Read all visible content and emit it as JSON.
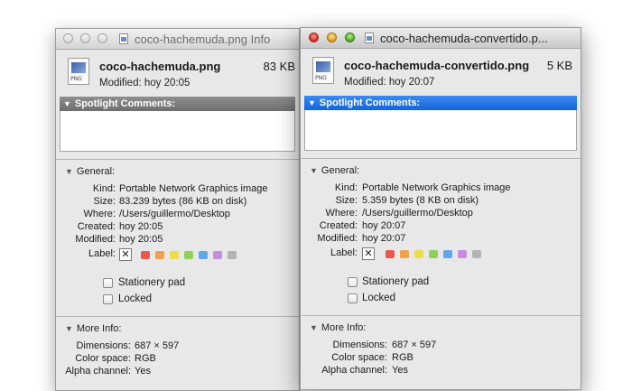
{
  "colors": {
    "spotlight_inactive": "#787878",
    "spotlight_active": "#1f6fe5",
    "labels": [
      "#e8584e",
      "#f3a04a",
      "#eedc4a",
      "#8fd25a",
      "#5fa6ea",
      "#c48de0",
      "#b3b3b3"
    ]
  },
  "windows": [
    {
      "title": "coco-hachemuda.png Info",
      "file_name": "coco-hachemuda.png",
      "file_size": "83 KB",
      "modified_summary": "Modified: hoy 20:05",
      "spotlight_label": "Spotlight Comments:",
      "general_label": "General:",
      "general": [
        {
          "k": "Kind:",
          "v": "Portable Network Graphics image"
        },
        {
          "k": "Size:",
          "v": "83.239 bytes (86 KB on disk)"
        },
        {
          "k": "Where:",
          "v": "/Users/guillermo/Desktop"
        },
        {
          "k": "Created:",
          "v": "hoy 20:05"
        },
        {
          "k": "Modified:",
          "v": "hoy 20:05"
        }
      ],
      "label_key": "Label:",
      "label_none": "✕",
      "stationery": "Stationery pad",
      "locked": "Locked",
      "more_label": "More Info:",
      "more": [
        {
          "k": "Dimensions:",
          "v": "687 × 597"
        },
        {
          "k": "Color space:",
          "v": "RGB"
        },
        {
          "k": "Alpha channel:",
          "v": "Yes"
        }
      ]
    },
    {
      "title": "coco-hachemuda-convertido.p...",
      "file_name": "coco-hachemuda-convertido.png",
      "file_size": "5 KB",
      "modified_summary": "Modified: hoy 20:07",
      "spotlight_label": "Spotlight Comments:",
      "general_label": "General:",
      "general": [
        {
          "k": "Kind:",
          "v": "Portable Network Graphics image"
        },
        {
          "k": "Size:",
          "v": "5.359 bytes (8 KB on disk)"
        },
        {
          "k": "Where:",
          "v": "/Users/guillermo/Desktop"
        },
        {
          "k": "Created:",
          "v": "hoy 20:07"
        },
        {
          "k": "Modified:",
          "v": "hoy 20:07"
        }
      ],
      "label_key": "Label:",
      "label_none": "✕",
      "stationery": "Stationery pad",
      "locked": "Locked",
      "more_label": "More Info:",
      "more": [
        {
          "k": "Dimensions:",
          "v": "687 × 597"
        },
        {
          "k": "Color space:",
          "v": "RGB"
        },
        {
          "k": "Alpha channel:",
          "v": "Yes"
        }
      ]
    }
  ]
}
